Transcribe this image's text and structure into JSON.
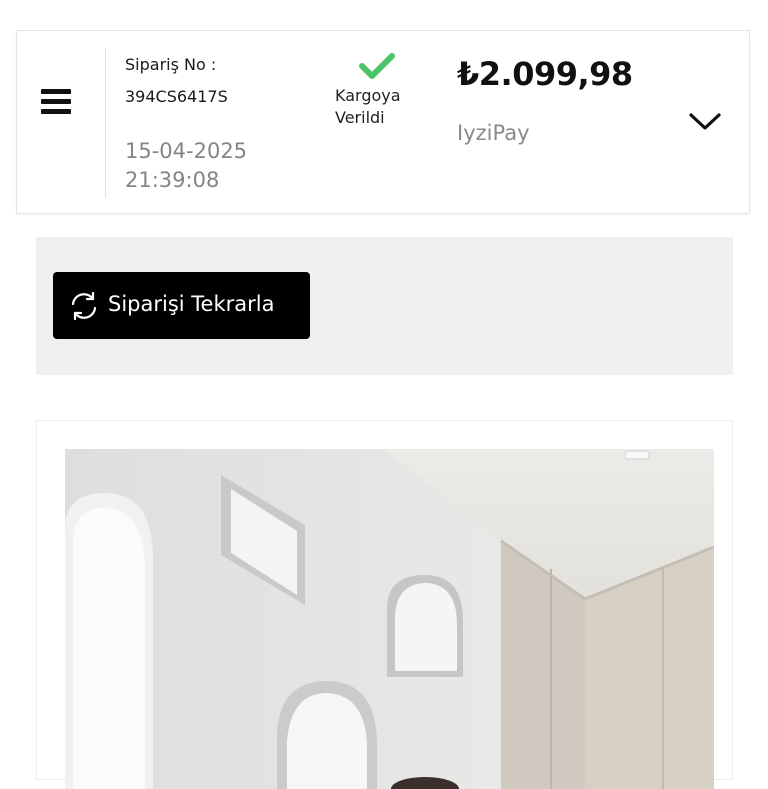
{
  "order": {
    "order_no_label": "Sipariş No :",
    "order_no": "394CS6417S",
    "date": "15-04-2025",
    "time": "21:39:08",
    "status_line1": "Kargoya",
    "status_line2": "Verildi",
    "status_icon": "check-icon",
    "status_color": "#4cc56a",
    "price": "₺2.099,98",
    "payment_method": "IyziPay"
  },
  "actions": {
    "reorder_label": "Siparişi Tekrarla",
    "reorder_icon": "refresh-icon"
  },
  "product": {
    "image": "product-photo"
  },
  "colors": {
    "accent": "#000000",
    "muted_text": "#858585",
    "panel_bg": "#f0f0f0"
  }
}
